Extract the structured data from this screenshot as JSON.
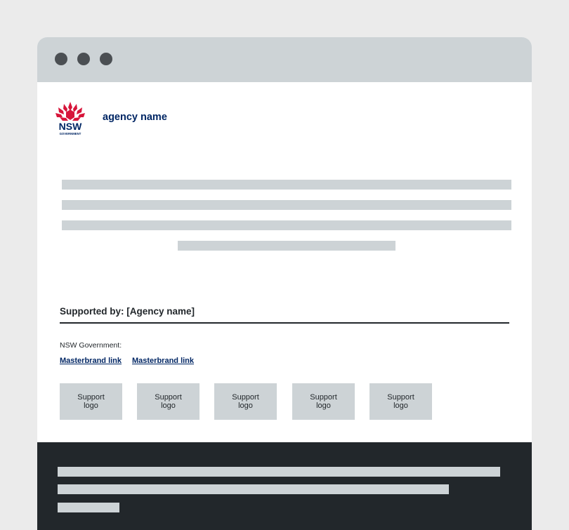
{
  "header": {
    "logo_text": "NSW",
    "logo_subtext": "GOVERNMENT",
    "agency_name": "agency name"
  },
  "supported": {
    "title": "Supported by: [Agency name]",
    "nsw_gov_label": "NSW Government:",
    "links": [
      "Masterbrand link",
      "Masterbrand link"
    ],
    "support_logos": [
      "Support logo",
      "Support logo",
      "Support logo",
      "Support logo",
      "Support logo"
    ]
  },
  "colors": {
    "page_bg": "#ebebeb",
    "titlebar": "#cdd3d6",
    "window_dot": "#4b4f53",
    "placeholder": "#cdd3d6",
    "brand_blue": "#002664",
    "waratah_red": "#d7153a",
    "footer": "#22272b"
  },
  "icons": {
    "window_controls": [
      "window-dot-icon",
      "window-dot-icon",
      "window-dot-icon"
    ],
    "logo": "nsw-waratah-logo"
  }
}
